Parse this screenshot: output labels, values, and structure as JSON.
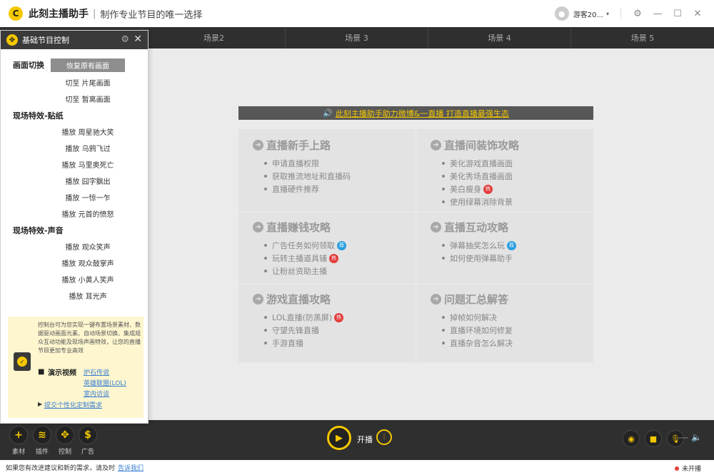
{
  "app": {
    "logo": "C",
    "name": "此刻主播助手",
    "separator": "|",
    "slogan": "制作专业节目的唯一选择"
  },
  "user": {
    "name": "游客20...",
    "caret": "▾"
  },
  "window": {
    "settings": "⚙",
    "minimize": "—",
    "maximize": "☐",
    "close": "✕"
  },
  "scenes": [
    "",
    "场景2",
    "场景 3",
    "场景 4",
    "场景 5"
  ],
  "panel": {
    "title": "基础节目控制",
    "gear": "⚙",
    "close": "✕",
    "sections": [
      {
        "title": "画面切换",
        "button": "恢复原有画面",
        "items": [
          "切至 片尾画面",
          "切至 暂离画面"
        ]
      },
      {
        "title": "现场特效-贴纸",
        "items": [
          "播放 周星驰大笑",
          "播放 乌鸦飞过",
          "播放 马里奥死亡",
          "播放 囧字飘出",
          "播放 一惊一乍",
          "播放 元首的愤怒"
        ]
      },
      {
        "title": "现场特效-声音",
        "items": [
          "播放 观众笑声",
          "播放 观众鼓掌声",
          "播放 小黄人笑声",
          "播放 耳光声"
        ]
      }
    ],
    "info": {
      "text": "控制台可为您实现一键布置场景素材、数据驱动画面元素、自动场景切换、集成观众互动功能及现场声画特效，让您的直播节目更加专业高效",
      "demo_label": "演示视频",
      "demo_links": [
        "炉石传说",
        "英雄联盟(LOL)",
        "室内访谈"
      ],
      "submit": "提交个性化定制需求"
    }
  },
  "banner": {
    "speaker": "🔊",
    "text": "此刻主播助手助力微博&一直播 打造直播最强生态"
  },
  "guides": [
    {
      "title": "直播新手上路",
      "items": [
        {
          "text": "申请直播权限",
          "badge": ""
        },
        {
          "text": "获取推流地址和直播码",
          "badge": ""
        },
        {
          "text": "直播硬件推荐",
          "badge": ""
        }
      ]
    },
    {
      "title": "直播间装饰攻略",
      "items": [
        {
          "text": "美化游戏直播画面",
          "badge": ""
        },
        {
          "text": "美化秀场直播画面",
          "badge": ""
        },
        {
          "text": "美白瘦身",
          "badge": "热"
        },
        {
          "text": "使用绿幕消除背景",
          "badge": ""
        }
      ]
    },
    {
      "title": "直播赚钱攻略",
      "items": [
        {
          "text": "广告任务如何领取",
          "badge": "荐"
        },
        {
          "text": "玩转主播道具铺",
          "badge": "热"
        },
        {
          "text": "让粉丝资助主播",
          "badge": ""
        }
      ]
    },
    {
      "title": "直播互动攻略",
      "items": [
        {
          "text": "弹幕抽奖怎么玩",
          "badge": "荐"
        },
        {
          "text": "如何使用弹幕助手",
          "badge": ""
        }
      ]
    },
    {
      "title": "游戏直播攻略",
      "items": [
        {
          "text": "LOL直播(防黑屏)",
          "badge": "热"
        },
        {
          "text": "守望先锋直播",
          "badge": ""
        },
        {
          "text": "手游直播",
          "badge": ""
        }
      ]
    },
    {
      "title": "问题汇总解答",
      "items": [
        {
          "text": "掉帧如何解决",
          "badge": ""
        },
        {
          "text": "直播环境如何修复",
          "badge": ""
        },
        {
          "text": "直播杂音怎么解决",
          "badge": ""
        }
      ]
    }
  ],
  "toolbar": {
    "tools": [
      {
        "icon": "+",
        "label": "素材"
      },
      {
        "icon": "≋",
        "label": "插件"
      },
      {
        "icon": "✥",
        "label": "控制"
      },
      {
        "icon": "$",
        "label": "广告"
      }
    ],
    "play_icon": "▶",
    "play_label": "开播",
    "mixer_icon": "⫶",
    "camera_icon": "◉",
    "video_icon": "■",
    "mic_icon": "🎙",
    "mic_dots": "·······",
    "speaker_icon": "🔈"
  },
  "status": {
    "message": "如果您有改进建议和新的需求，请及时",
    "link": "告诉我们",
    "state": "未开播"
  },
  "colors": {
    "accent": "#f5c800",
    "dark": "#2f2f2f",
    "hot": "#e43c3c",
    "recommend": "#2a9fe0"
  }
}
